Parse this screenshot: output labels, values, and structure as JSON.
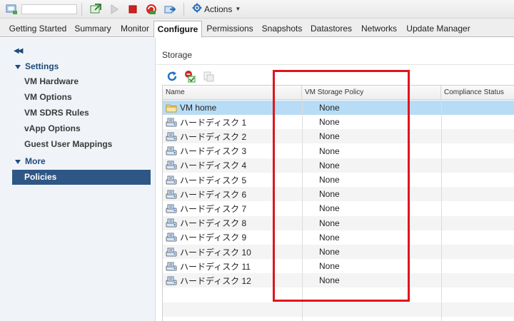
{
  "toolbar": {
    "actions_label": "Actions"
  },
  "tabs": [
    {
      "label": "Getting Started"
    },
    {
      "label": "Summary"
    },
    {
      "label": "Monitor"
    },
    {
      "label": "Configure",
      "active": true
    },
    {
      "label": "Permissions"
    },
    {
      "label": "Snapshots"
    },
    {
      "label": "Datastores"
    },
    {
      "label": "Networks"
    },
    {
      "label": "Update Manager"
    }
  ],
  "sidebar": {
    "collapse_icon": "double-chevron-left-icon",
    "sections": [
      {
        "title": "Settings",
        "items": [
          {
            "label": "VM Hardware"
          },
          {
            "label": "VM Options"
          },
          {
            "label": "VM SDRS Rules"
          },
          {
            "label": "vApp Options"
          },
          {
            "label": "Guest User Mappings"
          }
        ]
      },
      {
        "title": "More",
        "items": [
          {
            "label": "Policies",
            "selected": true
          }
        ]
      }
    ]
  },
  "main": {
    "title": "Storage",
    "buttons": [
      {
        "icon": "refresh-icon"
      },
      {
        "icon": "check-compliance-icon"
      },
      {
        "icon": "reapply-policy-icon"
      }
    ],
    "columns": [
      "Name",
      "VM Storage Policy",
      "Compliance Status"
    ],
    "rows": [
      {
        "name": "VM home",
        "icon": "folder-icon",
        "policy": "None"
      },
      {
        "name": "ハードディスク 1",
        "icon": "hard-disk-icon",
        "policy": "None"
      },
      {
        "name": "ハードディスク 2",
        "icon": "hard-disk-icon",
        "policy": "None"
      },
      {
        "name": "ハードディスク 3",
        "icon": "hard-disk-icon",
        "policy": "None"
      },
      {
        "name": "ハードディスク 4",
        "icon": "hard-disk-icon",
        "policy": "None"
      },
      {
        "name": "ハードディスク 5",
        "icon": "hard-disk-icon",
        "policy": "None"
      },
      {
        "name": "ハードディスク 6",
        "icon": "hard-disk-icon",
        "policy": "None"
      },
      {
        "name": "ハードディスク 7",
        "icon": "hard-disk-icon",
        "policy": "None"
      },
      {
        "name": "ハードディスク 8",
        "icon": "hard-disk-icon",
        "policy": "None"
      },
      {
        "name": "ハードディスク 9",
        "icon": "hard-disk-icon",
        "policy": "None"
      },
      {
        "name": "ハードディスク 10",
        "icon": "hard-disk-icon",
        "policy": "None"
      },
      {
        "name": "ハードディスク 11",
        "icon": "hard-disk-icon",
        "policy": "None"
      },
      {
        "name": "ハードディスク 12",
        "icon": "hard-disk-icon",
        "policy": "None"
      }
    ]
  },
  "colors": {
    "selected_nav_bg": "#2f5785",
    "selected_row_bg": "#b8dcf5",
    "highlight_box": "#e0141c"
  }
}
